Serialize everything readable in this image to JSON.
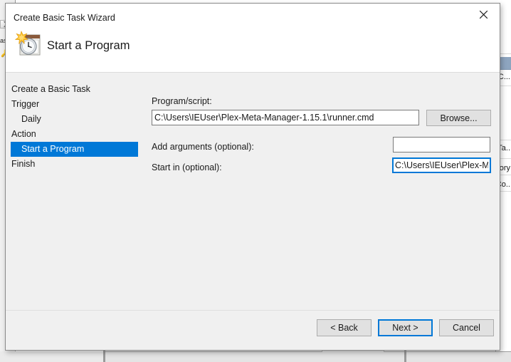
{
  "window": {
    "title": "Create Basic Task Wizard",
    "close_icon": "close-icon",
    "heading": "Start a Program",
    "heading_icon": "task-scheduler-clock-calendar-icon"
  },
  "steps": [
    {
      "label": "Create a Basic Task",
      "sub": false,
      "selected": false
    },
    {
      "label": "Trigger",
      "sub": false,
      "selected": false
    },
    {
      "label": "Daily",
      "sub": true,
      "selected": false
    },
    {
      "label": "Action",
      "sub": false,
      "selected": false
    },
    {
      "label": "Start a Program",
      "sub": true,
      "selected": true
    },
    {
      "label": "Finish",
      "sub": false,
      "selected": false
    }
  ],
  "form": {
    "program_label": "Program/script:",
    "program_value": "C:\\Users\\IEUser\\Plex-Meta-Manager-1.15.1\\runner.cmd",
    "program_placeholder": "",
    "browse_label": "Browse...",
    "arguments_label": "Add arguments (optional):",
    "arguments_value": "",
    "arguments_placeholder": "",
    "startin_label": "Start in (optional):",
    "startin_value": "C:\\Users\\IEUser\\Plex-Me",
    "startin_placeholder": ""
  },
  "footer": {
    "back_label": "< Back",
    "next_label": "Next >",
    "cancel_label": "Cancel"
  },
  "background": {
    "left_label": "as",
    "right_rows": [
      "C...",
      "Ta..",
      "ory",
      "Co.."
    ]
  },
  "colors": {
    "accent": "#0078d7",
    "dialog_face": "#f0f0f0",
    "header_face": "#ffffff",
    "button_face": "#e1e1e1",
    "text": "#1a1a1a"
  }
}
